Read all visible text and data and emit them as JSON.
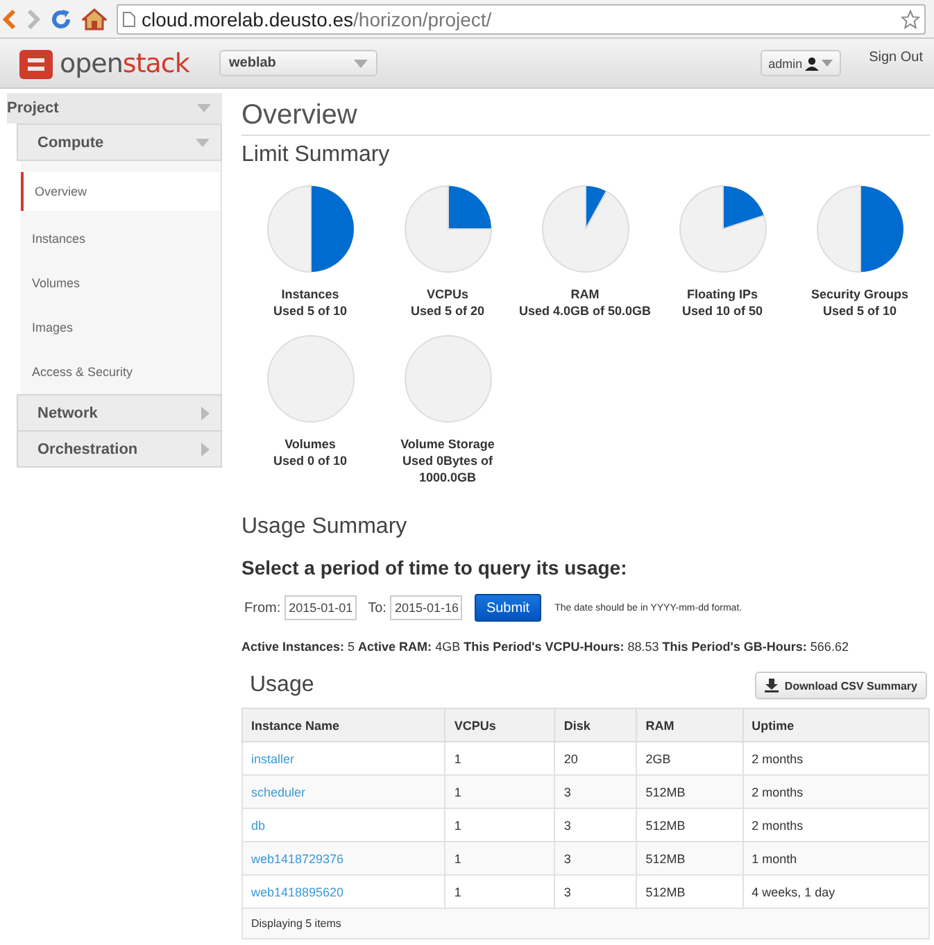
{
  "browser": {
    "url_host": "cloud.morelab.deusto.es",
    "url_path": "/horizon/project/"
  },
  "header": {
    "logo_text_light": "open",
    "logo_text_bold": "stack",
    "project": "weblab",
    "user": "admin",
    "sign_out": "Sign Out"
  },
  "sidebar": {
    "panel": "Project",
    "groups": [
      {
        "label": "Compute",
        "expanded": true,
        "items": [
          {
            "label": "Overview",
            "selected": true
          },
          {
            "label": "Instances",
            "selected": false
          },
          {
            "label": "Volumes",
            "selected": false
          },
          {
            "label": "Images",
            "selected": false
          },
          {
            "label": "Access & Security",
            "selected": false
          }
        ]
      },
      {
        "label": "Network",
        "expanded": false
      },
      {
        "label": "Orchestration",
        "expanded": false
      }
    ]
  },
  "page_title": "Overview",
  "limit_summary": {
    "title": "Limit Summary",
    "limits": [
      {
        "name": "Instances",
        "used": "Used 5 of 10",
        "chart_data": {
          "type": "pie",
          "values": [
            50,
            50
          ]
        }
      },
      {
        "name": "VCPUs",
        "used": "Used 5 of 20",
        "chart_data": {
          "type": "pie",
          "values": [
            25,
            75
          ]
        }
      },
      {
        "name": "RAM",
        "used": "Used 4.0GB of 50.0GB",
        "chart_data": {
          "type": "pie",
          "values": [
            8,
            92
          ]
        }
      },
      {
        "name": "Floating IPs",
        "used": "Used 10 of 50",
        "chart_data": {
          "type": "pie",
          "values": [
            20,
            80
          ]
        }
      },
      {
        "name": "Security Groups",
        "used": "Used 5 of 10",
        "chart_data": {
          "type": "pie",
          "values": [
            50,
            50
          ]
        }
      },
      {
        "name": "Volumes",
        "used": "Used 0 of 10",
        "chart_data": {
          "type": "pie",
          "values": [
            0,
            100
          ]
        }
      },
      {
        "name": "Volume Storage",
        "used": "Used 0Bytes of 1000.0GB",
        "chart_data": {
          "type": "pie",
          "values": [
            0,
            100
          ]
        }
      }
    ]
  },
  "usage_summary": {
    "title": "Usage Summary",
    "subtitle": "Select a period of time to query its usage:",
    "from_label": "From:",
    "from_value": "2015-01-01",
    "to_label": "To:",
    "to_value": "2015-01-16",
    "submit": "Submit",
    "hint": "The date should be in YYYY-mm-dd format.",
    "stats": "**Active Instances:** 5 **Active RAM:** 4GB **This Period's VCPU-Hours:** 88.53 **This Period's GB-Hours:** 566.62"
  },
  "usage": {
    "title": "Usage",
    "download": "Download CSV Summary",
    "columns": [
      "Instance Name",
      "VCPUs",
      "Disk",
      "RAM",
      "Uptime"
    ],
    "rows": [
      [
        "installer",
        "1",
        "20",
        "2GB",
        "2 months"
      ],
      [
        "scheduler",
        "1",
        "3",
        "512MB",
        "2 months"
      ],
      [
        "db",
        "1",
        "3",
        "512MB",
        "2 months"
      ],
      [
        "web1418729376",
        "1",
        "3",
        "512MB",
        "1 month"
      ],
      [
        "web1418895620",
        "1",
        "3",
        "512MB",
        "4 weeks, 1 day"
      ]
    ],
    "footer": "Displaying 5 items"
  }
}
